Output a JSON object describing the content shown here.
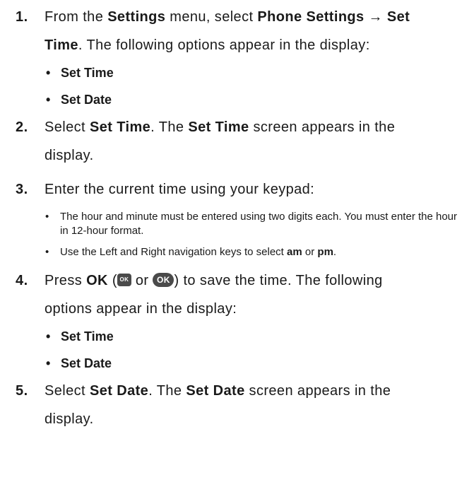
{
  "steps": [
    {
      "num": "1.",
      "line1": {
        "t1": "From the ",
        "b1": "Settings",
        "t2": " menu, select ",
        "b2": "Phone Settings → Set"
      },
      "line2": {
        "b1": "Time",
        "t1": ". The following options appear in the display:"
      },
      "bullets": [
        "Set Time",
        "Set Date"
      ]
    },
    {
      "num": "2.",
      "line1": {
        "t1": "Select ",
        "b1": "Set Time",
        "t2": ". The ",
        "b2": "Set Time",
        "t3": " screen appears in the"
      },
      "line2": "display."
    },
    {
      "num": "3.",
      "line1": "Enter the current time using your keypad:",
      "bullet1": "The hour and minute must be entered using two digits each. You must enter the hour in 12-hour format.",
      "bullet2": {
        "t1": "Use the Left and Right navigation keys to select ",
        "b1": "am",
        "t2": " or ",
        "b2": "pm",
        "t3": "."
      }
    },
    {
      "num": "4.",
      "line1": {
        "t1": "Press ",
        "b1": "OK",
        "t2": " (",
        "t3": " or ",
        "t4": ") to save the time. The following"
      },
      "line2": "options appear in the display:",
      "icon_small": "OK",
      "icon_large": "OK",
      "bullets": [
        "Set Time",
        "Set Date"
      ]
    },
    {
      "num": "5.",
      "line1": {
        "t1": "Select ",
        "b1": "Set Date",
        "t2": ". The ",
        "b2": "Set Date",
        "t3": " screen appears in the"
      },
      "line2": "display."
    }
  ],
  "bullet_glyph": "•",
  "colors": {
    "text": "#1a1a1a",
    "icon_bg": "#4a4a4a"
  }
}
